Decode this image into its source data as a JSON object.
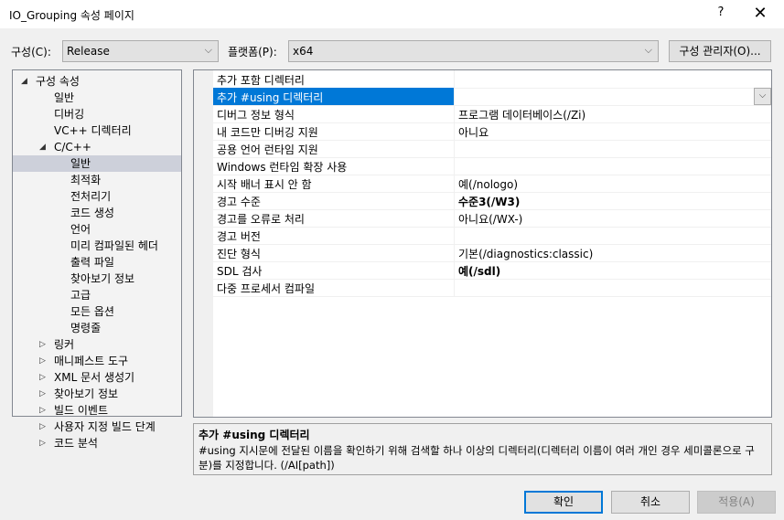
{
  "window": {
    "title": "IO_Grouping 속성 페이지",
    "help_label": "?",
    "close_label": "✕"
  },
  "toolbar": {
    "config_label": "구성(C):",
    "config_value": "Release",
    "platform_label": "플랫폼(P):",
    "platform_value": "x64",
    "config_manager_label": "구성 관리자(O)..."
  },
  "tree": {
    "items": [
      {
        "label": "구성 속성",
        "level": 0,
        "expander": "expanded"
      },
      {
        "label": "일반",
        "level": 1,
        "expander": "none"
      },
      {
        "label": "디버깅",
        "level": 1,
        "expander": "none"
      },
      {
        "label": "VC++ 디렉터리",
        "level": 1,
        "expander": "none"
      },
      {
        "label": "C/C++",
        "level": 1,
        "expander": "expanded"
      },
      {
        "label": "일반",
        "level": 2,
        "expander": "none",
        "selected": true
      },
      {
        "label": "최적화",
        "level": 2,
        "expander": "none"
      },
      {
        "label": "전처리기",
        "level": 2,
        "expander": "none"
      },
      {
        "label": "코드 생성",
        "level": 2,
        "expander": "none"
      },
      {
        "label": "언어",
        "level": 2,
        "expander": "none"
      },
      {
        "label": "미리 컴파일된 헤더",
        "level": 2,
        "expander": "none"
      },
      {
        "label": "출력 파일",
        "level": 2,
        "expander": "none"
      },
      {
        "label": "찾아보기 정보",
        "level": 2,
        "expander": "none"
      },
      {
        "label": "고급",
        "level": 2,
        "expander": "none"
      },
      {
        "label": "모든 옵션",
        "level": 2,
        "expander": "none"
      },
      {
        "label": "명령줄",
        "level": 2,
        "expander": "none"
      },
      {
        "label": "링커",
        "level": 1,
        "expander": "collapsed"
      },
      {
        "label": "매니페스트 도구",
        "level": 1,
        "expander": "collapsed"
      },
      {
        "label": "XML 문서 생성기",
        "level": 1,
        "expander": "collapsed"
      },
      {
        "label": "찾아보기 정보",
        "level": 1,
        "expander": "collapsed"
      },
      {
        "label": "빌드 이벤트",
        "level": 1,
        "expander": "collapsed"
      },
      {
        "label": "사용자 지정 빌드 단계",
        "level": 1,
        "expander": "collapsed"
      },
      {
        "label": "코드 분석",
        "level": 1,
        "expander": "collapsed"
      }
    ]
  },
  "properties": [
    {
      "name": "추가 포함 디렉터리",
      "value": "",
      "bold": false
    },
    {
      "name": "추가 #using 디렉터리",
      "value": "",
      "bold": false,
      "selected": true
    },
    {
      "name": "디버그 정보 형식",
      "value": "프로그램 데이터베이스(/Zi)",
      "bold": false
    },
    {
      "name": "내 코드만 디버깅 지원",
      "value": "아니요",
      "bold": false
    },
    {
      "name": "공용 언어 런타임 지원",
      "value": "",
      "bold": false
    },
    {
      "name": "Windows 런타임 확장 사용",
      "value": "",
      "bold": false
    },
    {
      "name": "시작 배너 표시 안 함",
      "value": "예(/nologo)",
      "bold": false
    },
    {
      "name": "경고 수준",
      "value": "수준3(/W3)",
      "bold": true
    },
    {
      "name": "경고를 오류로 처리",
      "value": "아니요(/WX-)",
      "bold": false
    },
    {
      "name": "경고 버전",
      "value": "",
      "bold": false
    },
    {
      "name": "진단 형식",
      "value": "기본(/diagnostics:classic)",
      "bold": false
    },
    {
      "name": "SDL 검사",
      "value": "예(/sdl)",
      "bold": true
    },
    {
      "name": "다중 프로세서 컴파일",
      "value": "",
      "bold": false
    }
  ],
  "description": {
    "title": "추가 #using 디렉터리",
    "text": "#using 지시문에 전달된 이름을 확인하기 위해 검색할 하나 이상의 디렉터리(디렉터리 이름이 여러 개인 경우 세미콜론으로 구분)를 지정합니다.  (/AI[path])"
  },
  "buttons": {
    "ok": "확인",
    "cancel": "취소",
    "apply": "적용(A)"
  },
  "icons": {
    "expanded": "◢",
    "collapsed": "▷",
    "dropdown": "⌵"
  },
  "colors": {
    "selection": "#0078d7",
    "tree_selection": "#cdd0da"
  }
}
